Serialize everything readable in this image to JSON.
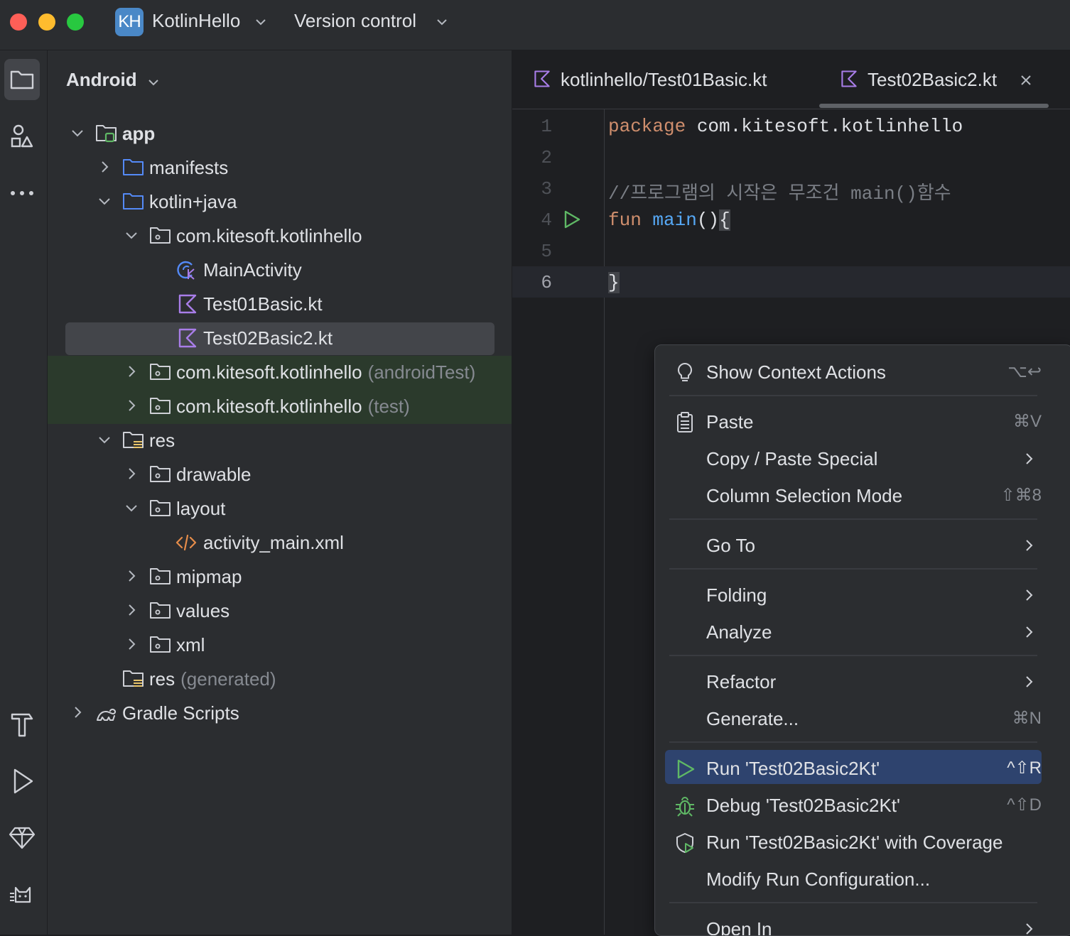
{
  "titlebar": {
    "project_badge": "KH",
    "project_name": "KotlinHello",
    "vcs_label": "Version control"
  },
  "toolstrip": {
    "top_icons": [
      "folder-icon",
      "structure-icon",
      "more-icon"
    ],
    "bottom_icons": [
      "build-hammer-icon",
      "run-icon",
      "gem-icon",
      "cat-icon"
    ]
  },
  "project": {
    "view_label": "Android",
    "tree": [
      {
        "label": "app",
        "sub": "",
        "icon": "module-icon"
      },
      {
        "label": "manifests",
        "sub": "",
        "icon": "folder-icon"
      },
      {
        "label": "kotlin+java",
        "sub": "",
        "icon": "folder-icon"
      },
      {
        "label": "com.kitesoft.kotlinhello",
        "sub": "",
        "icon": "package-icon"
      },
      {
        "label": "MainActivity",
        "sub": "",
        "icon": "activity-class-icon"
      },
      {
        "label": "Test01Basic.kt",
        "sub": "",
        "icon": "kotlin-file-icon"
      },
      {
        "label": "Test02Basic2.kt",
        "sub": "",
        "icon": "kotlin-file-icon"
      },
      {
        "label": "com.kitesoft.kotlinhello",
        "sub": "(androidTest)",
        "icon": "package-icon"
      },
      {
        "label": "com.kitesoft.kotlinhello",
        "sub": "(test)",
        "icon": "package-icon"
      },
      {
        "label": "res",
        "sub": "",
        "icon": "res-folder-icon"
      },
      {
        "label": "drawable",
        "sub": "",
        "icon": "package-icon"
      },
      {
        "label": "layout",
        "sub": "",
        "icon": "package-icon"
      },
      {
        "label": "activity_main.xml",
        "sub": "",
        "icon": "xml-file-icon"
      },
      {
        "label": "mipmap",
        "sub": "",
        "icon": "package-icon"
      },
      {
        "label": "values",
        "sub": "",
        "icon": "package-icon"
      },
      {
        "label": "xml",
        "sub": "",
        "icon": "package-icon"
      },
      {
        "label": "res",
        "sub": "(generated)",
        "icon": "res-folder-icon"
      },
      {
        "label": "Gradle Scripts",
        "sub": "",
        "icon": "gradle-icon"
      }
    ]
  },
  "editor": {
    "tabs": [
      {
        "label": "kotlinhello/Test01Basic.kt",
        "active": false
      },
      {
        "label": "Test02Basic2.kt",
        "active": true
      }
    ],
    "line_numbers": [
      "1",
      "2",
      "3",
      "4",
      "5",
      "6"
    ],
    "code": {
      "l1_kw": "package",
      "l1_rest": " com.kitesoft.kotlinhello",
      "l3_comment": "//프로그램의 시작은 무조건 main()함수",
      "l4_kw": "fun",
      "l4_fn": "main",
      "l4_parens": "()",
      "l4_brace": "{",
      "l6_brace": "}"
    }
  },
  "context_menu": {
    "items": [
      {
        "label": "Show Context Actions",
        "shortcut": "⌥↩",
        "icon": "bulb-icon"
      },
      {
        "label": "Paste",
        "shortcut": "⌘V",
        "icon": "clipboard-icon"
      },
      {
        "label": "Copy / Paste Special",
        "shortcut": "",
        "submenu": true
      },
      {
        "label": "Column Selection Mode",
        "shortcut": "⇧⌘8"
      },
      {
        "label": "Go To",
        "shortcut": "",
        "submenu": true
      },
      {
        "label": "Folding",
        "shortcut": "",
        "submenu": true
      },
      {
        "label": "Analyze",
        "shortcut": "",
        "submenu": true
      },
      {
        "label": "Refactor",
        "shortcut": "",
        "submenu": true
      },
      {
        "label": "Generate...",
        "shortcut": "⌘N"
      },
      {
        "label": "Run 'Test02Basic2Kt'",
        "shortcut": "^⇧R",
        "icon": "run-icon",
        "highlighted": true
      },
      {
        "label": "Debug 'Test02Basic2Kt'",
        "shortcut": "^⇧D",
        "icon": "debug-bug-icon"
      },
      {
        "label": "Run 'Test02Basic2Kt' with Coverage",
        "shortcut": "",
        "icon": "coverage-icon"
      },
      {
        "label": "Modify Run Configuration...",
        "shortcut": ""
      },
      {
        "label": "Open In",
        "shortcut": "",
        "submenu": true
      }
    ]
  },
  "colors": {
    "accent_selection": "#2e436e",
    "keyword": "#cf8e6d",
    "function": "#56a8f5",
    "comment": "#7a7e85",
    "kotlin_icon": "#a87de8",
    "run_green": "#5fb865"
  }
}
